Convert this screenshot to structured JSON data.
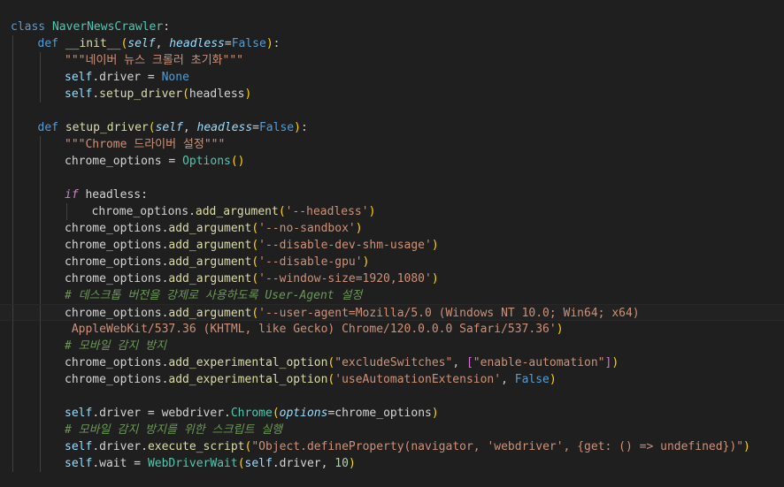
{
  "editor": {
    "language": "python",
    "colors": {
      "background": "#1f1f1f",
      "keyword": "#569cd6",
      "class_name": "#4ec9b0",
      "function": "#dcdcaa",
      "self": "#9cdcfe",
      "string": "#ce9178",
      "number": "#b5cea8",
      "comment": "#6a9955",
      "bracket_level_1": "#ffd700",
      "bracket_level_2": "#da70d6",
      "bracket_level_3": "#179fff"
    },
    "lines": [
      {
        "indent": 0,
        "tokens": [
          {
            "t": "class ",
            "c": "kw"
          },
          {
            "t": "NaverNewsCrawler",
            "c": "cls"
          },
          {
            "t": ":",
            "c": "txt"
          }
        ]
      },
      {
        "indent": 1,
        "tokens": [
          {
            "t": "def ",
            "c": "kw"
          },
          {
            "t": "__init__",
            "c": "fn"
          },
          {
            "t": "(",
            "c": "bk1"
          },
          {
            "t": "self",
            "c": "prm"
          },
          {
            "t": ", ",
            "c": "txt"
          },
          {
            "t": "headless",
            "c": "prm"
          },
          {
            "t": "=",
            "c": "txt"
          },
          {
            "t": "False",
            "c": "kw"
          },
          {
            "t": ")",
            "c": "bk1"
          },
          {
            "t": ":",
            "c": "txt"
          }
        ]
      },
      {
        "indent": 2,
        "tokens": [
          {
            "t": "\"\"\"네이버 뉴스 크롤러 초기화\"\"\"",
            "c": "str"
          }
        ]
      },
      {
        "indent": 2,
        "tokens": [
          {
            "t": "self",
            "c": "slf"
          },
          {
            "t": ".driver = ",
            "c": "var"
          },
          {
            "t": "None",
            "c": "kw"
          }
        ]
      },
      {
        "indent": 2,
        "tokens": [
          {
            "t": "self",
            "c": "slf"
          },
          {
            "t": ".",
            "c": "var"
          },
          {
            "t": "setup_driver",
            "c": "fn"
          },
          {
            "t": "(",
            "c": "bk1"
          },
          {
            "t": "headless",
            "c": "var"
          },
          {
            "t": ")",
            "c": "bk1"
          }
        ]
      },
      {
        "indent": 0,
        "tokens": []
      },
      {
        "indent": 1,
        "tokens": [
          {
            "t": "def ",
            "c": "kw"
          },
          {
            "t": "setup_driver",
            "c": "fn"
          },
          {
            "t": "(",
            "c": "bk1"
          },
          {
            "t": "self",
            "c": "prm"
          },
          {
            "t": ", ",
            "c": "txt"
          },
          {
            "t": "headless",
            "c": "prm"
          },
          {
            "t": "=",
            "c": "txt"
          },
          {
            "t": "False",
            "c": "kw"
          },
          {
            "t": ")",
            "c": "bk1"
          },
          {
            "t": ":",
            "c": "txt"
          }
        ]
      },
      {
        "indent": 2,
        "tokens": [
          {
            "t": "\"\"\"Chrome 드라이버 설정\"\"\"",
            "c": "str"
          }
        ]
      },
      {
        "indent": 2,
        "tokens": [
          {
            "t": "chrome_options = ",
            "c": "var"
          },
          {
            "t": "Options",
            "c": "cls"
          },
          {
            "t": "()",
            "c": "bk1"
          }
        ]
      },
      {
        "indent": 0,
        "tokens": []
      },
      {
        "indent": 2,
        "tokens": [
          {
            "t": "if",
            "c": "ctl"
          },
          {
            "t": " headless:",
            "c": "var"
          }
        ]
      },
      {
        "indent": 3,
        "tokens": [
          {
            "t": "chrome_options.",
            "c": "var"
          },
          {
            "t": "add_argument",
            "c": "fn"
          },
          {
            "t": "(",
            "c": "bk1"
          },
          {
            "t": "'--headless'",
            "c": "str"
          },
          {
            "t": ")",
            "c": "bk1"
          }
        ]
      },
      {
        "indent": 2,
        "tokens": [
          {
            "t": "chrome_options.",
            "c": "var"
          },
          {
            "t": "add_argument",
            "c": "fn"
          },
          {
            "t": "(",
            "c": "bk1"
          },
          {
            "t": "'--no-sandbox'",
            "c": "str"
          },
          {
            "t": ")",
            "c": "bk1"
          }
        ]
      },
      {
        "indent": 2,
        "tokens": [
          {
            "t": "chrome_options.",
            "c": "var"
          },
          {
            "t": "add_argument",
            "c": "fn"
          },
          {
            "t": "(",
            "c": "bk1"
          },
          {
            "t": "'--disable-dev-shm-usage'",
            "c": "str"
          },
          {
            "t": ")",
            "c": "bk1"
          }
        ]
      },
      {
        "indent": 2,
        "tokens": [
          {
            "t": "chrome_options.",
            "c": "var"
          },
          {
            "t": "add_argument",
            "c": "fn"
          },
          {
            "t": "(",
            "c": "bk1"
          },
          {
            "t": "'--disable-gpu'",
            "c": "str"
          },
          {
            "t": ")",
            "c": "bk1"
          }
        ]
      },
      {
        "indent": 2,
        "tokens": [
          {
            "t": "chrome_options.",
            "c": "var"
          },
          {
            "t": "add_argument",
            "c": "fn"
          },
          {
            "t": "(",
            "c": "bk1"
          },
          {
            "t": "'--window-size=1920,1080'",
            "c": "str"
          },
          {
            "t": ")",
            "c": "bk1"
          }
        ]
      },
      {
        "indent": 2,
        "tokens": [
          {
            "t": "# 데스크톱 버전을 강제로 사용하도록 User-Agent 설정",
            "c": "cmt"
          }
        ]
      },
      {
        "indent": 2,
        "current": true,
        "tokens": [
          {
            "t": "chrome_options.",
            "c": "var"
          },
          {
            "t": "add_argument",
            "c": "fn"
          },
          {
            "t": "(",
            "c": "bk1"
          },
          {
            "t": "'--user-agent=Mozilla/5.0 (Windows NT 10.0; Win64; x64)",
            "c": "str"
          }
        ]
      },
      {
        "indent": 2,
        "wrap": true,
        "tokens": [
          {
            "t": " AppleWebKit/537.36 (KHTML, like Gecko) Chrome/120.0.0.0 Safari/537.36'",
            "c": "str"
          },
          {
            "t": ")",
            "c": "bk1"
          }
        ]
      },
      {
        "indent": 2,
        "tokens": [
          {
            "t": "# 모바일 감지 방지",
            "c": "cmt"
          }
        ]
      },
      {
        "indent": 2,
        "tokens": [
          {
            "t": "chrome_options.",
            "c": "var"
          },
          {
            "t": "add_experimental_option",
            "c": "fn"
          },
          {
            "t": "(",
            "c": "bk1"
          },
          {
            "t": "\"excludeSwitches\"",
            "c": "str"
          },
          {
            "t": ", ",
            "c": "txt"
          },
          {
            "t": "[",
            "c": "bk2"
          },
          {
            "t": "\"enable-automation\"",
            "c": "str"
          },
          {
            "t": "]",
            "c": "bk2"
          },
          {
            "t": ")",
            "c": "bk1"
          }
        ]
      },
      {
        "indent": 2,
        "tokens": [
          {
            "t": "chrome_options.",
            "c": "var"
          },
          {
            "t": "add_experimental_option",
            "c": "fn"
          },
          {
            "t": "(",
            "c": "bk1"
          },
          {
            "t": "'useAutomationExtension'",
            "c": "str"
          },
          {
            "t": ", ",
            "c": "txt"
          },
          {
            "t": "False",
            "c": "kw"
          },
          {
            "t": ")",
            "c": "bk1"
          }
        ]
      },
      {
        "indent": 0,
        "tokens": []
      },
      {
        "indent": 2,
        "tokens": [
          {
            "t": "self",
            "c": "slf"
          },
          {
            "t": ".driver = webdriver.",
            "c": "var"
          },
          {
            "t": "Chrome",
            "c": "cls"
          },
          {
            "t": "(",
            "c": "bk1"
          },
          {
            "t": "options",
            "c": "prm"
          },
          {
            "t": "=chrome_options",
            "c": "var"
          },
          {
            "t": ")",
            "c": "bk1"
          }
        ]
      },
      {
        "indent": 2,
        "tokens": [
          {
            "t": "# 모바일 감지 방지를 위한 스크립트 실행",
            "c": "cmt"
          }
        ]
      },
      {
        "indent": 2,
        "tokens": [
          {
            "t": "self",
            "c": "slf"
          },
          {
            "t": ".driver.",
            "c": "var"
          },
          {
            "t": "execute_script",
            "c": "fn"
          },
          {
            "t": "(",
            "c": "bk1"
          },
          {
            "t": "\"Object.defineProperty(navigator, 'webdriver', {get: () => undefined})\"",
            "c": "str"
          },
          {
            "t": ")",
            "c": "bk1"
          }
        ]
      },
      {
        "indent": 2,
        "tokens": [
          {
            "t": "self",
            "c": "slf"
          },
          {
            "t": ".wait = ",
            "c": "var"
          },
          {
            "t": "WebDriverWait",
            "c": "cls"
          },
          {
            "t": "(",
            "c": "bk1"
          },
          {
            "t": "self",
            "c": "slf"
          },
          {
            "t": ".driver, ",
            "c": "var"
          },
          {
            "t": "10",
            "c": "num"
          },
          {
            "t": ")",
            "c": "bk1"
          }
        ]
      }
    ]
  }
}
